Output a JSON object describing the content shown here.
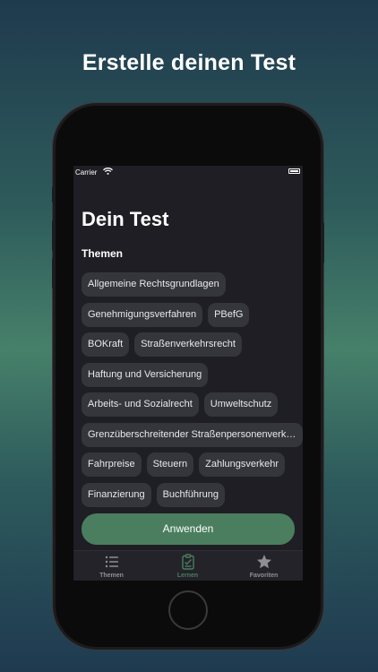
{
  "headline": "Erstelle deinen Test",
  "status": {
    "carrier": "Carrier"
  },
  "screen": {
    "title": "Dein Test",
    "section_label": "Themen",
    "chips": [
      "Allgemeine Rechtsgrundlagen",
      "Genehmigungsverfahren",
      "PBefG",
      "BOKraft",
      "Straßenverkehrsrecht",
      "Haftung und Versicherung",
      "Arbeits- und Sozialrecht",
      "Umweltschutz",
      "Grenzüberschreitender Straßenpersonenverkehr",
      "Fahrpreise",
      "Steuern",
      "Zahlungsverkehr",
      "Finanzierung",
      "Buchführung"
    ],
    "apply_button": "Anwenden"
  },
  "tabbar": {
    "tabs": [
      {
        "label": "Themen",
        "icon": "list-icon",
        "active": false
      },
      {
        "label": "Lernen",
        "icon": "clipboard-icon",
        "active": true
      },
      {
        "label": "Favoriten",
        "icon": "star-icon",
        "active": false
      }
    ]
  },
  "colors": {
    "accent": "#4a7e5e",
    "chip_bg": "#35363c",
    "screen_bg": "#1e1e24",
    "tab_inactive": "#8e8e93",
    "tab_active": "#4a7e5e"
  }
}
